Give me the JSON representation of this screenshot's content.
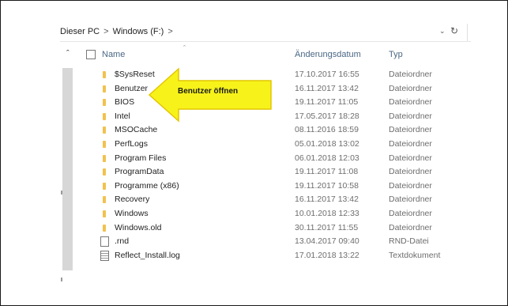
{
  "address_bar": {
    "segments": [
      "Dieser PC",
      "Windows (F:)"
    ],
    "separator": ">",
    "dropdown_icon": "chevron-down-icon",
    "refresh_icon": "refresh-icon"
  },
  "columns": {
    "name": "Name",
    "date": "Änderungsdatum",
    "type": "Typ"
  },
  "callout": {
    "text": "Benutzer öffnen",
    "color": "#f7f31a",
    "border_color": "#e3c500"
  },
  "files": [
    {
      "name": "$SysReset",
      "date": "17.10.2017 16:55",
      "type": "Dateiordner",
      "icon": "folder-icon"
    },
    {
      "name": "Benutzer",
      "date": "16.11.2017 13:42",
      "type": "Dateiordner",
      "icon": "folder-icon"
    },
    {
      "name": "BIOS",
      "date": "19.11.2017 11:05",
      "type": "Dateiordner",
      "icon": "folder-icon"
    },
    {
      "name": "Intel",
      "date": "17.05.2017 18:28",
      "type": "Dateiordner",
      "icon": "folder-icon"
    },
    {
      "name": "MSOCache",
      "date": "08.11.2016 18:59",
      "type": "Dateiordner",
      "icon": "folder-icon"
    },
    {
      "name": "PerfLogs",
      "date": "05.01.2018 13:02",
      "type": "Dateiordner",
      "icon": "folder-icon"
    },
    {
      "name": "Program Files",
      "date": "06.01.2018 12:03",
      "type": "Dateiordner",
      "icon": "folder-icon"
    },
    {
      "name": "ProgramData",
      "date": "19.11.2017 11:08",
      "type": "Dateiordner",
      "icon": "folder-icon"
    },
    {
      "name": "Programme (x86)",
      "date": "19.11.2017 10:58",
      "type": "Dateiordner",
      "icon": "folder-icon"
    },
    {
      "name": "Recovery",
      "date": "16.11.2017 13:42",
      "type": "Dateiordner",
      "icon": "folder-icon"
    },
    {
      "name": "Windows",
      "date": "10.01.2018 12:33",
      "type": "Dateiordner",
      "icon": "folder-icon"
    },
    {
      "name": "Windows.old",
      "date": "30.11.2017 11:55",
      "type": "Dateiordner",
      "icon": "folder-icon"
    },
    {
      "name": ".rnd",
      "date": "13.04.2017 09:40",
      "type": "RND-Datei",
      "icon": "file-icon"
    },
    {
      "name": "Reflect_Install.log",
      "date": "17.01.2018 13:22",
      "type": "Textdokument",
      "icon": "text-file-icon"
    }
  ]
}
